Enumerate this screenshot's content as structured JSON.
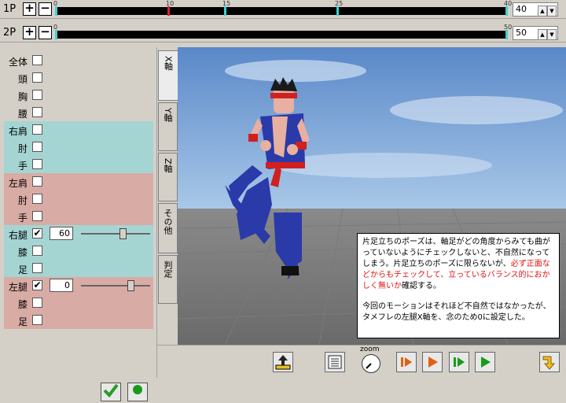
{
  "tracks": [
    {
      "label": "1P",
      "plus": "+",
      "minus": "−",
      "value": "40",
      "ticks": [
        {
          "pos": 0,
          "label": "0"
        },
        {
          "pos": 10,
          "label": "10",
          "red": true
        },
        {
          "pos": 15,
          "label": "15"
        },
        {
          "pos": 25,
          "label": "25"
        },
        {
          "pos": 40,
          "label": "40"
        }
      ],
      "max": 40
    },
    {
      "label": "2P",
      "plus": "+",
      "minus": "−",
      "value": "50",
      "ticks": [
        {
          "pos": 0,
          "label": "0"
        },
        {
          "pos": 50,
          "label": "50"
        }
      ],
      "max": 50
    }
  ],
  "parts": {
    "all": "全体",
    "head": "頭",
    "chest": "胸",
    "waist": "腰",
    "r_shoulder": "右肩",
    "r_elbow": "肘",
    "r_hand": "手",
    "l_shoulder": "左肩",
    "l_elbow": "肘",
    "l_hand": "手",
    "r_thigh": "右腿",
    "r_thigh_value": "60",
    "r_thigh_slider": 0.62,
    "r_knee": "膝",
    "r_foot": "足",
    "l_thigh": "左腿",
    "l_thigh_value": "0",
    "l_thigh_slider": 0.75,
    "l_knee": "膝",
    "l_foot": "足"
  },
  "tabs": {
    "x": "X軸",
    "y": "Y軸",
    "z": "Z軸",
    "other": "その他",
    "judge": "判定"
  },
  "zoom_label": "zoom",
  "info": {
    "line1": "片足立ちのポーズは、軸足がどの角度からみても曲がっていないようにチェックしないと、不自然になってしまう。片足立ちのポーズに限らないが、",
    "red": "必ず正面などからもチェックして、立っているバランス的におかしく無いか",
    "line1_end": "確認する。",
    "line2": "今回のモーションはそれほど不自然ではなかったが、タメフレの左腿X軸を、念のため0に設定した。"
  },
  "colors": {
    "cyan": "#a5d5d3",
    "pink": "#d9aba5",
    "sky": "#6f9bd0"
  }
}
